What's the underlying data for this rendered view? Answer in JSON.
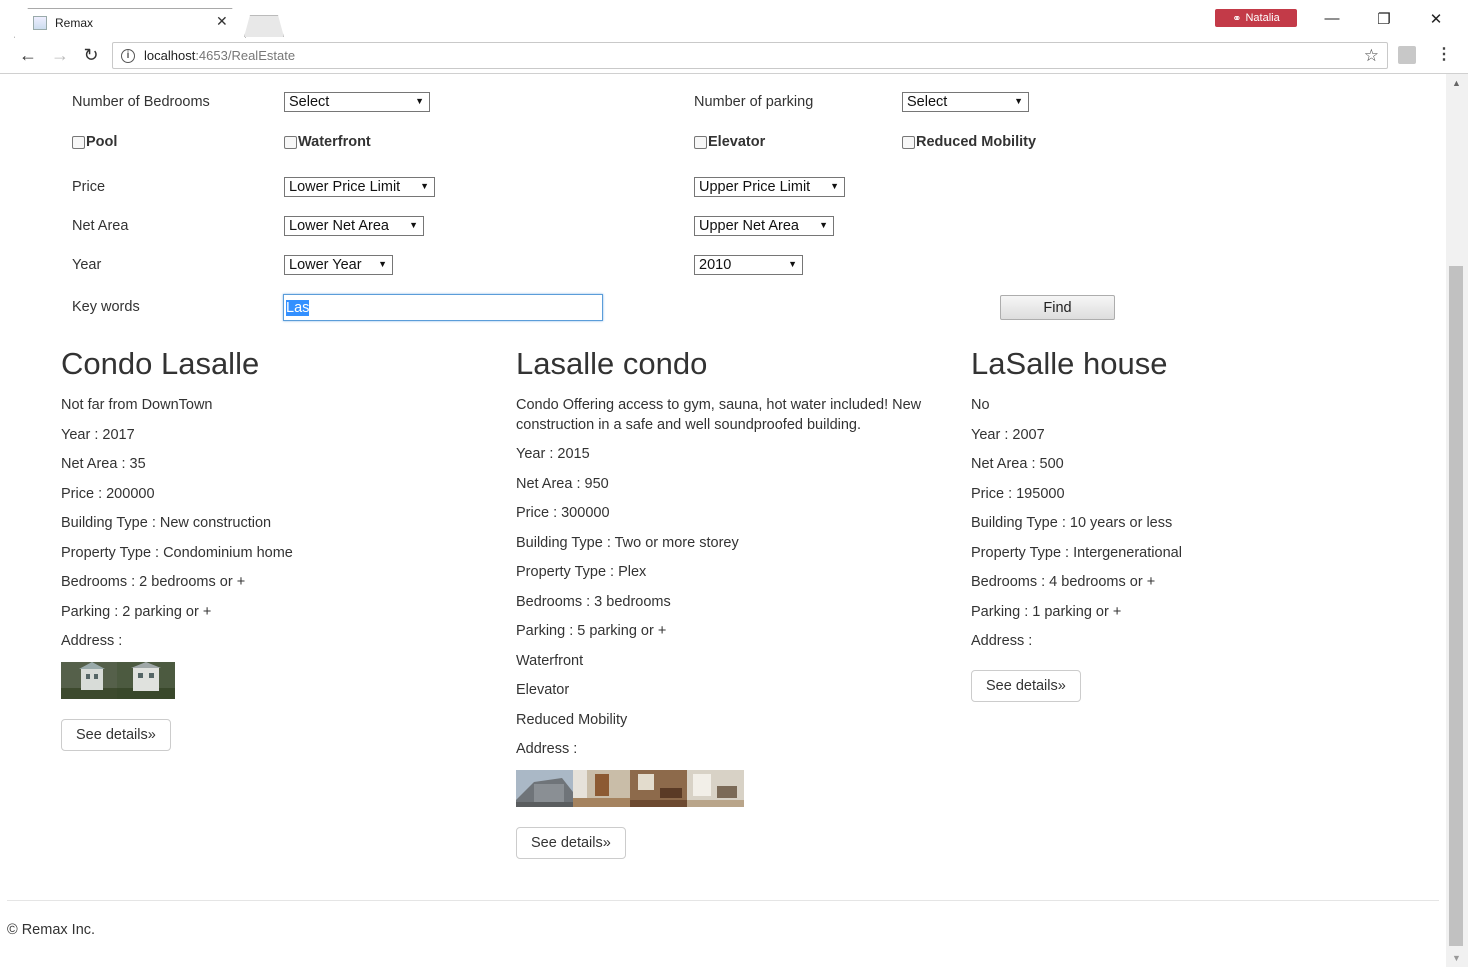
{
  "browser": {
    "tab_title": "Remax",
    "profile_name": "Natalia",
    "url_host": "localhost",
    "url_path": ":4653/RealEstate"
  },
  "form": {
    "bedrooms_label": "Number of Bedrooms",
    "bedrooms_value": "Select",
    "parking_label": "Number of parking",
    "parking_value": "Select",
    "checkboxes": [
      {
        "label": "Pool",
        "checked": false
      },
      {
        "label": "Waterfront",
        "checked": false
      },
      {
        "label": "Elevator",
        "checked": false
      },
      {
        "label": "Reduced Mobility",
        "checked": false
      }
    ],
    "price_label": "Price",
    "price_lower": "Lower Price Limit",
    "price_upper": "Upper Price Limit",
    "area_label": "Net Area",
    "area_lower": "Lower Net Area",
    "area_upper": "Upper Net Area",
    "year_label": "Year",
    "year_lower": "Lower Year",
    "year_upper": "2010",
    "keywords_label": "Key words",
    "keywords_value": "Las",
    "find_label": "Find"
  },
  "listings": [
    {
      "title": "Condo Lasalle",
      "description": "Not far from DownTown",
      "year": "Year : 2017",
      "area": "Net Area : 35",
      "price": "Price : 200000",
      "building": "Building Type : New construction",
      "property": "Property Type : Condominium home",
      "bedrooms": "Bedrooms : 2 bedrooms or +",
      "parking": "Parking : 2 parking or +",
      "address": "Address :",
      "details": "See details»"
    },
    {
      "title": "Lasalle condo",
      "description": "Condo Offering access to gym, sauna, hot water included! New construction in a safe and well soundproofed building.",
      "year": "Year : 2015",
      "area": "Net Area : 950",
      "price": "Price : 300000",
      "building": "Building Type : Two or more storey",
      "property": "Property Type : Plex",
      "bedrooms": "Bedrooms : 3 bedrooms",
      "parking": "Parking : 5 parking or +",
      "feature1": "Waterfront",
      "feature2": "Elevator",
      "feature3": "Reduced Mobility",
      "address": "Address :",
      "details": "See details»"
    },
    {
      "title": "LaSalle house",
      "description": "No",
      "year": "Year : 2007",
      "area": "Net Area : 500",
      "price": "Price : 195000",
      "building": "Building Type : 10 years or less",
      "property": "Property Type : Intergenerational",
      "bedrooms": "Bedrooms : 4 bedrooms or +",
      "parking": "Parking : 1 parking or +",
      "address": "Address :",
      "details": "See details»"
    }
  ],
  "footer": {
    "text": "© Remax Inc."
  },
  "colors": {
    "profile_badge": "#c33a48",
    "input_focus": "#5b9dd9",
    "text_selection": "#3390ff"
  }
}
